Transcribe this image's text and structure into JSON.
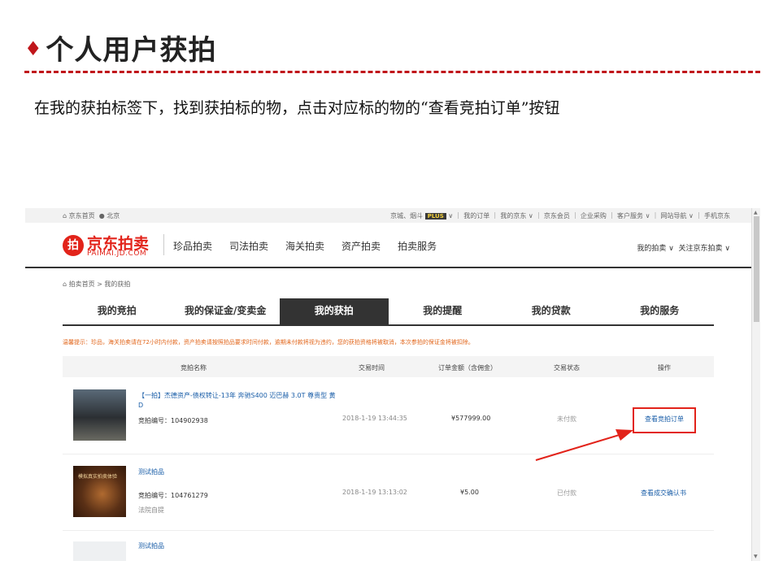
{
  "slide": {
    "title_marker": "♦",
    "title": "个人用户获拍",
    "caption": "在我的获拍标签下，找到获拍标的物，点击对应标的物的“查看竞拍订单”按钮"
  },
  "site": {
    "topbar_left": "京东首页",
    "location": "北京",
    "topbar_right": "京城、烟斗",
    "plus_badge": "PLUS",
    "topbar_links": "我的订单 ｜ 我的京东 ∨ ｜ 京东会员 ｜ 企业采购 ｜ 客户服务 ∨ ｜ 网站导航 ∨ ｜ 手机京东",
    "logo_cn": "京东拍卖",
    "logo_en": "PAIMAI.JD.COM",
    "nav": [
      "珍品拍卖",
      "司法拍卖",
      "海关拍卖",
      "资产拍卖",
      "拍卖服务"
    ],
    "user_links": [
      "我的拍卖 ∨",
      "关注京东拍卖 ∨"
    ],
    "breadcrumb": "拍卖首页 > 我的获拍"
  },
  "tabs": [
    "我的竞拍",
    "我的保证金/变卖金",
    "我的获拍",
    "我的提醒",
    "我的贷款",
    "我的服务"
  ],
  "active_tab": 2,
  "notice": "温馨提示：珍品，海关拍卖请在72小时内付款，资产拍卖请按照拍品要求时间付款，逾期未付款将视为违约，您的获拍资格将被取消，本次参拍的保证金将被扣除。",
  "table": {
    "headers": [
      "竞拍名称",
      "交易时间",
      "订单金额（含佣金）",
      "交易状态",
      "操作"
    ],
    "rows": [
      {
        "name": "【一拍】杰德资产-债权转让-13年 奔驰S400 迈巴赫 3.0T 尊贵型 黄D",
        "number": "竞拍编号：104902938",
        "sub": "",
        "time": "2018-1-19 13:44:35",
        "amount": "¥577999.00",
        "status": "未付款",
        "action": "查看竞拍订单"
      },
      {
        "name": "测试拍品",
        "thumb_text": "模拟真实拍卖体验",
        "number": "竞拍编号：104761279",
        "sub": "法院自提",
        "time": "2018-1-19 13:13:02",
        "amount": "¥5.00",
        "status": "已付款",
        "action": "查看成交确认书"
      },
      {
        "name": "测试拍品"
      }
    ]
  },
  "colors": {
    "accent": "#c0161b",
    "brand_red": "#e2231a",
    "link": "#1a5ea8",
    "notice": "#e2661b"
  }
}
